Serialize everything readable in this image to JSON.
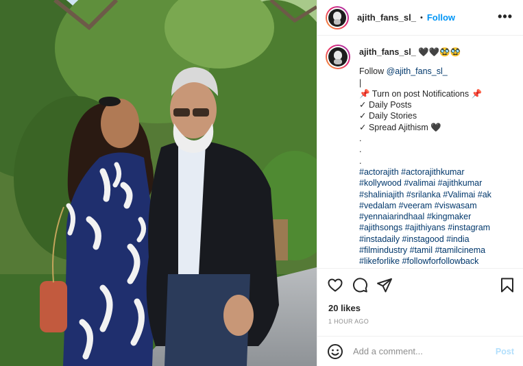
{
  "post": {
    "username": "ajith_fans_sl_",
    "follow_label": "Follow",
    "separator": "•",
    "more_label": "•••"
  },
  "caption": {
    "username": "ajith_fans_sl_",
    "username_suffix": "🖤🖤🥸🥸",
    "lines": [
      "Follow ",
      "|",
      "📌 Turn on post Notifications 📌",
      "✓ Daily Posts",
      "✓ Daily Stories",
      "✓ Spread Ajithism 🖤",
      ".",
      ".",
      "."
    ],
    "mention": "@ajith_fans_sl_",
    "hashtag_lines": [
      "#actorajith #actorajithkumar",
      "#kollywood #valimai #ajithkumar",
      "#shaliniajith #srilanka #Valimai #ak",
      "#vedalam #veeram #viswasam",
      "#yennaiarindhaal #kingmaker",
      "#ajithsongs #ajithiyans #instagram",
      "#instadaily #instagood #india",
      "#filmindustry #tamil #tamilcinema",
      "#likeforlike #followforfollowback"
    ]
  },
  "actions": {
    "icons": [
      "heart-icon",
      "comment-icon",
      "share-icon",
      "bookmark-icon"
    ]
  },
  "likes": "20 likes",
  "timestamp": "1 HOUR AGO",
  "comment": {
    "placeholder": "Add a comment...",
    "post_label": "Post"
  },
  "colors": {
    "link": "#00376b",
    "follow": "#0095f6",
    "post_disabled": "#b2dffc",
    "muted": "#8e8e8e"
  }
}
